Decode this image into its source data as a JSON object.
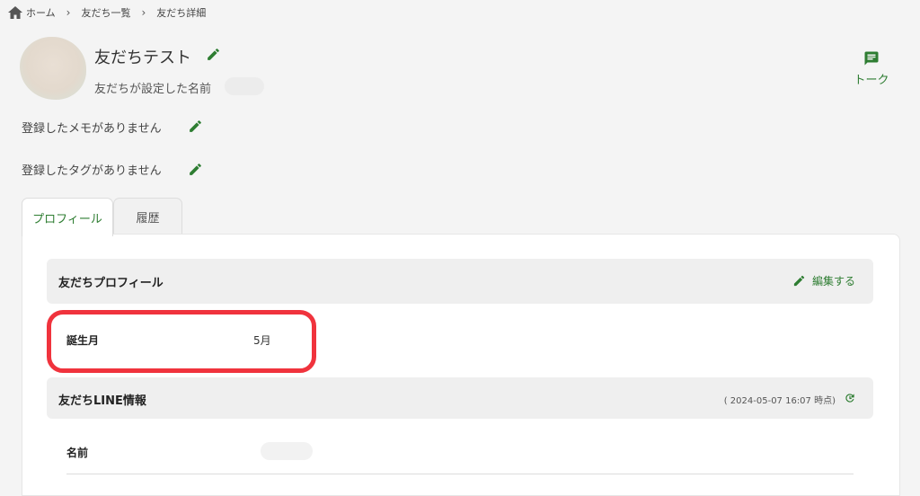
{
  "breadcrumb": {
    "home": "ホーム",
    "list": "友だち一覧",
    "current": "友だち詳細"
  },
  "friend": {
    "name": "友だちテスト",
    "custom_name_label": "友だちが設定した名前"
  },
  "talk_label": "トーク",
  "memo_empty": "登録したメモがありません",
  "tag_empty": "登録したタグがありません",
  "tabs": [
    {
      "label": "プロフィール"
    },
    {
      "label": "履歴"
    }
  ],
  "profile_section": {
    "title": "友だちプロフィール",
    "edit_label": "編集する",
    "rows": [
      {
        "label": "誕生月",
        "value": "5月"
      }
    ]
  },
  "line_section": {
    "title": "友だちLINE情報",
    "timestamp": "( 2024-05-07 16:07 時点)",
    "rows": [
      {
        "label": "名前"
      }
    ]
  },
  "colors": {
    "accent": "#2e7d32",
    "highlight": "#f0333d"
  },
  "icons": [
    "home-icon",
    "chevron-right-icon",
    "pencil-icon",
    "chat-icon",
    "refresh-icon"
  ]
}
